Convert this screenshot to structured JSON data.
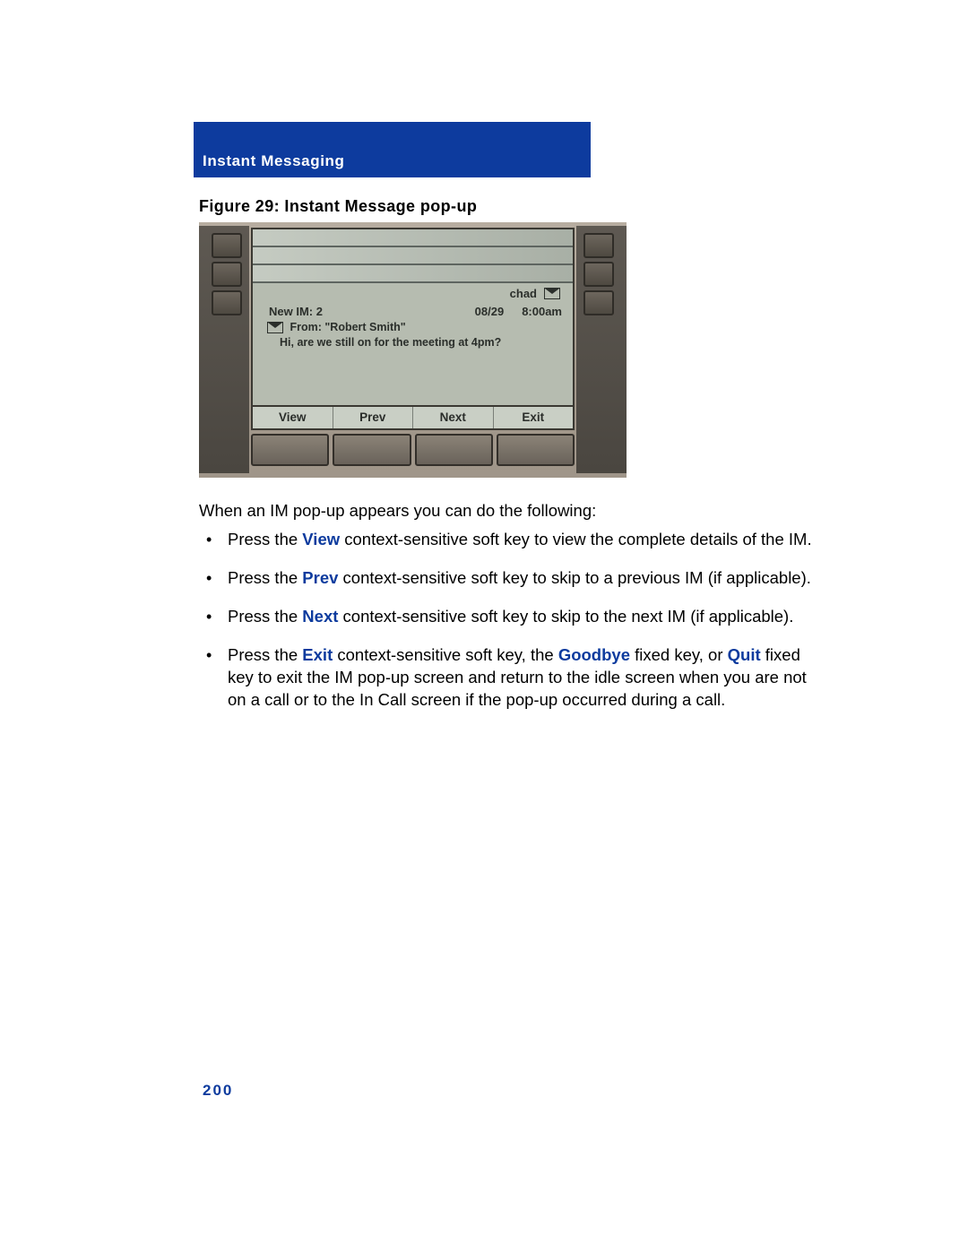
{
  "header": {
    "title": "Instant Messaging"
  },
  "figure": {
    "caption": "Figure 29: Instant Message pop-up"
  },
  "phone": {
    "status": {
      "name": "chad"
    },
    "info": {
      "new_im": "New IM: 2",
      "date": "08/29",
      "time": "8:00am"
    },
    "message": {
      "from_label": "From: \"Robert Smith\"",
      "body": "Hi, are we still on for the meeting at 4pm?"
    },
    "softkeys": [
      "View",
      "Prev",
      "Next",
      "Exit"
    ]
  },
  "intro": "When an IM pop-up appears you can do the following:",
  "bullets": {
    "b1": {
      "pre": "Press the ",
      "kw": "View",
      "post": " context-sensitive soft key to view the complete details of the IM."
    },
    "b2": {
      "pre": "Press the ",
      "kw": "Prev",
      "post": " context-sensitive soft key to skip to a previous IM (if applicable)."
    },
    "b3": {
      "pre": "Press the ",
      "kw": "Next",
      "post": " context-sensitive soft key to skip to the next IM (if applicable)."
    },
    "b4": {
      "pre": "Press the ",
      "kw1": "Exit",
      "mid1": " context-sensitive soft key, the ",
      "kw2": "Goodbye",
      "mid2": " fixed key, or ",
      "kw3": "Quit",
      "post": " fixed key to exit the IM pop-up screen and return to the idle screen when you are not on a call or to the In Call screen if the pop-up occurred during a call."
    }
  },
  "page_number": "200"
}
